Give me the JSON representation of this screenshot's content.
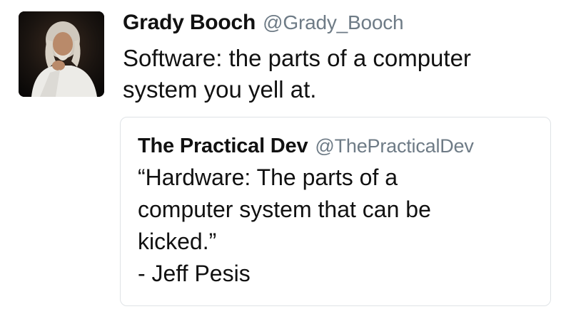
{
  "tweet": {
    "author_name": "Grady Booch",
    "author_handle": "@Grady_Booch",
    "text_lines": [
      "Software: the parts of a computer",
      "system you yell at."
    ]
  },
  "quoted_tweet": {
    "author_name": "The Practical Dev",
    "author_handle": "@ThePracticalDev",
    "text_lines": [
      "“Hardware: The parts of a",
      "computer system that can be",
      "kicked.”",
      "- Jeff Pesis"
    ]
  }
}
